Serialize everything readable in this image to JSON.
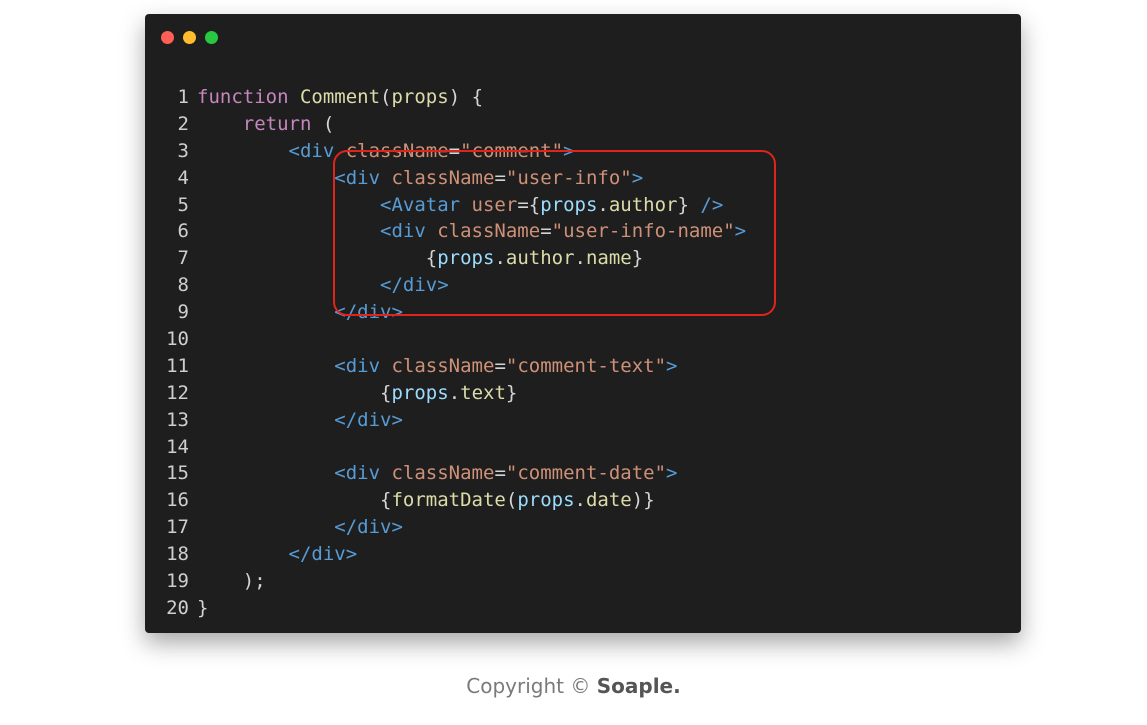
{
  "window": {
    "controls": [
      {
        "name": "close",
        "color": "#ff5f57"
      },
      {
        "name": "minimize",
        "color": "#febc2e"
      },
      {
        "name": "maximize",
        "color": "#28c840"
      }
    ]
  },
  "code": {
    "colors": {
      "keyword": "#c586c0",
      "func": "#dcdcaa",
      "tag": "#569cd6",
      "attr": "#ce9178",
      "string": "#ce9178",
      "var": "#9cdcfe",
      "prop": "#dcdcaa",
      "plain": "#d4d4d4",
      "highlight": "#e0241b"
    },
    "lines": [
      {
        "num": "1",
        "tokens": [
          {
            "t": "function ",
            "c": "keyword"
          },
          {
            "t": "Comment",
            "c": "func"
          },
          {
            "t": "(",
            "c": "plain"
          },
          {
            "t": "props",
            "c": "prop"
          },
          {
            "t": ") {",
            "c": "plain"
          }
        ]
      },
      {
        "num": "2",
        "tokens": [
          {
            "t": "    ",
            "c": "plain"
          },
          {
            "t": "return",
            "c": "keyword"
          },
          {
            "t": " (",
            "c": "plain"
          }
        ]
      },
      {
        "num": "3",
        "tokens": [
          {
            "t": "        ",
            "c": "plain"
          },
          {
            "t": "<div ",
            "c": "tag"
          },
          {
            "t": "className",
            "c": "attr"
          },
          {
            "t": "=",
            "c": "plain"
          },
          {
            "t": "\"comment\"",
            "c": "string"
          },
          {
            "t": ">",
            "c": "tag"
          }
        ]
      },
      {
        "num": "4",
        "tokens": [
          {
            "t": "            ",
            "c": "plain"
          },
          {
            "t": "<div ",
            "c": "tag"
          },
          {
            "t": "className",
            "c": "attr"
          },
          {
            "t": "=",
            "c": "plain"
          },
          {
            "t": "\"user-info\"",
            "c": "string"
          },
          {
            "t": ">",
            "c": "tag"
          }
        ]
      },
      {
        "num": "5",
        "tokens": [
          {
            "t": "                ",
            "c": "plain"
          },
          {
            "t": "<Avatar ",
            "c": "tag"
          },
          {
            "t": "user",
            "c": "attr"
          },
          {
            "t": "={",
            "c": "plain"
          },
          {
            "t": "props",
            "c": "var"
          },
          {
            "t": ".",
            "c": "plain"
          },
          {
            "t": "author",
            "c": "prop"
          },
          {
            "t": "} ",
            "c": "plain"
          },
          {
            "t": "/>",
            "c": "tag"
          }
        ]
      },
      {
        "num": "6",
        "tokens": [
          {
            "t": "                ",
            "c": "plain"
          },
          {
            "t": "<div ",
            "c": "tag"
          },
          {
            "t": "className",
            "c": "attr"
          },
          {
            "t": "=",
            "c": "plain"
          },
          {
            "t": "\"user-info-name\"",
            "c": "string"
          },
          {
            "t": ">",
            "c": "tag"
          }
        ]
      },
      {
        "num": "7",
        "tokens": [
          {
            "t": "                    ",
            "c": "plain"
          },
          {
            "t": "{",
            "c": "plain"
          },
          {
            "t": "props",
            "c": "var"
          },
          {
            "t": ".",
            "c": "plain"
          },
          {
            "t": "author",
            "c": "prop"
          },
          {
            "t": ".",
            "c": "plain"
          },
          {
            "t": "name",
            "c": "prop"
          },
          {
            "t": "}",
            "c": "plain"
          }
        ]
      },
      {
        "num": "8",
        "tokens": [
          {
            "t": "                ",
            "c": "plain"
          },
          {
            "t": "</div>",
            "c": "tag"
          }
        ]
      },
      {
        "num": "9",
        "tokens": [
          {
            "t": "            ",
            "c": "plain"
          },
          {
            "t": "</div>",
            "c": "tag"
          }
        ]
      },
      {
        "num": "10",
        "tokens": []
      },
      {
        "num": "11",
        "tokens": [
          {
            "t": "            ",
            "c": "plain"
          },
          {
            "t": "<div ",
            "c": "tag"
          },
          {
            "t": "className",
            "c": "attr"
          },
          {
            "t": "=",
            "c": "plain"
          },
          {
            "t": "\"comment-text\"",
            "c": "string"
          },
          {
            "t": ">",
            "c": "tag"
          }
        ]
      },
      {
        "num": "12",
        "tokens": [
          {
            "t": "                ",
            "c": "plain"
          },
          {
            "t": "{",
            "c": "plain"
          },
          {
            "t": "props",
            "c": "var"
          },
          {
            "t": ".",
            "c": "plain"
          },
          {
            "t": "text",
            "c": "prop"
          },
          {
            "t": "}",
            "c": "plain"
          }
        ]
      },
      {
        "num": "13",
        "tokens": [
          {
            "t": "            ",
            "c": "plain"
          },
          {
            "t": "</div>",
            "c": "tag"
          }
        ]
      },
      {
        "num": "14",
        "tokens": []
      },
      {
        "num": "15",
        "tokens": [
          {
            "t": "            ",
            "c": "plain"
          },
          {
            "t": "<div ",
            "c": "tag"
          },
          {
            "t": "className",
            "c": "attr"
          },
          {
            "t": "=",
            "c": "plain"
          },
          {
            "t": "\"comment-date\"",
            "c": "string"
          },
          {
            "t": ">",
            "c": "tag"
          }
        ]
      },
      {
        "num": "16",
        "tokens": [
          {
            "t": "                ",
            "c": "plain"
          },
          {
            "t": "{",
            "c": "plain"
          },
          {
            "t": "formatDate",
            "c": "func"
          },
          {
            "t": "(",
            "c": "plain"
          },
          {
            "t": "props",
            "c": "var"
          },
          {
            "t": ".",
            "c": "plain"
          },
          {
            "t": "date",
            "c": "prop"
          },
          {
            "t": ")}",
            "c": "plain"
          }
        ]
      },
      {
        "num": "17",
        "tokens": [
          {
            "t": "            ",
            "c": "plain"
          },
          {
            "t": "</div>",
            "c": "tag"
          }
        ]
      },
      {
        "num": "18",
        "tokens": [
          {
            "t": "        ",
            "c": "plain"
          },
          {
            "t": "</div>",
            "c": "tag"
          }
        ]
      },
      {
        "num": "19",
        "tokens": [
          {
            "t": "    ",
            "c": "plain"
          },
          {
            "t": ");",
            "c": "plain"
          }
        ]
      },
      {
        "num": "20",
        "tokens": [
          {
            "t": "}",
            "c": "plain"
          }
        ]
      }
    ]
  },
  "footer": {
    "prefix": "Copyright © ",
    "brand": "Soaple."
  }
}
